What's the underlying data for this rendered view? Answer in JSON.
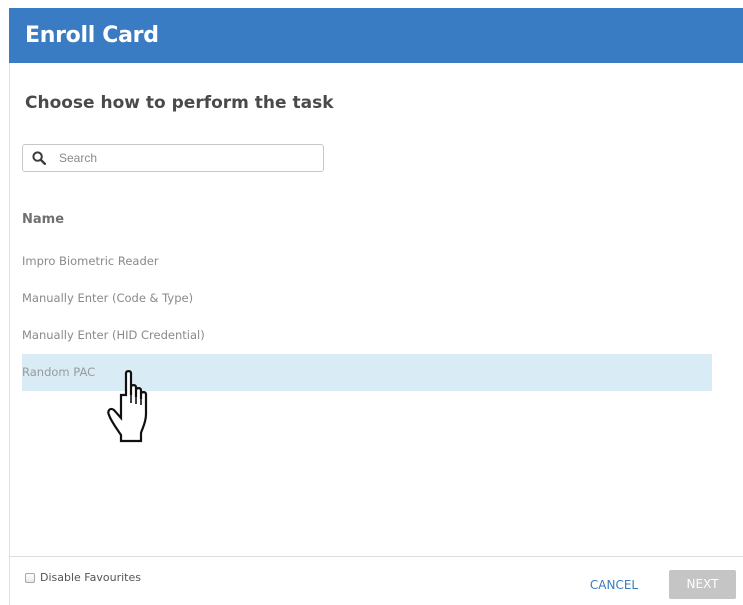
{
  "dialog": {
    "title": "Enroll Card",
    "heading": "Choose how to perform the task",
    "accent_color": "#3a7cc3"
  },
  "search": {
    "placeholder": "Search",
    "value": "",
    "icon": "search-icon"
  },
  "table": {
    "column_header": "Name",
    "items": [
      {
        "label": "Impro Biometric Reader",
        "selected": false
      },
      {
        "label": "Manually Enter (Code & Type)",
        "selected": false
      },
      {
        "label": "Manually Enter (HID Credential)",
        "selected": false
      },
      {
        "label": "Random PAC",
        "selected": true
      }
    ],
    "selected_color": "#d9ebf5"
  },
  "footer": {
    "disable_favourites_label": "Disable Favourites",
    "disable_favourites_checked": false,
    "cancel_label": "CANCEL",
    "next_label": "NEXT",
    "next_enabled": false
  },
  "cursor": {
    "type": "hand-pointer-icon"
  }
}
